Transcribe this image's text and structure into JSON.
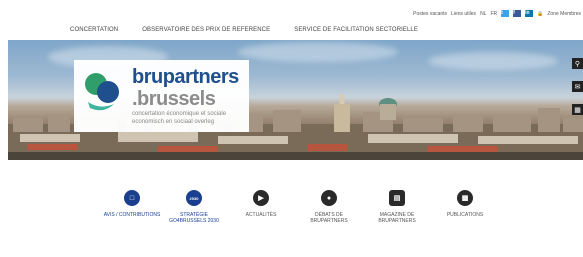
{
  "utility_bar": {
    "links": [
      "Postes vacants",
      "Liens utiles",
      "NL",
      "FR"
    ],
    "social": [
      "t",
      "f",
      "in"
    ],
    "member_zone": "Zone Membres"
  },
  "nav": {
    "items": [
      "CONCERTATION",
      "OBSERVATOIRE DES PRIX DE REFERENCE",
      "SERVICE DE FACILITATION SECTORIELLE"
    ]
  },
  "logo": {
    "name_line1": "brupartners",
    "name_line2": ".brussels",
    "subtitle_line1": "concertation économique et sociale",
    "subtitle_line2": "economisch en sociaal overleg"
  },
  "side_icons": [
    "search-icon",
    "mail-icon",
    "calendar-icon"
  ],
  "tiles": [
    {
      "label1": "AVIS / CONTRIBUTIONS",
      "label2": "",
      "icon": "document-icon",
      "accent": "#1b3f8f"
    },
    {
      "label1": "STRATÉGIE",
      "label2": "GO4BRUSSELS 2030",
      "icon": "2030-badge-icon",
      "icon_text": "2030",
      "accent": "#1b3f8f"
    },
    {
      "label1": "ACTUALITÉS",
      "label2": "",
      "icon": "megaphone-icon",
      "accent": "#2a2a2a"
    },
    {
      "label1": "DÉBATS DE",
      "label2": "BRUPARTNERS",
      "icon": "chat-icon",
      "accent": "#2a2a2a"
    },
    {
      "label1": "MAGAZINE DE",
      "label2": "BRUPARTNERS",
      "icon": "magazine-icon",
      "accent": "#2a2a2a"
    },
    {
      "label1": "PUBLICATIONS",
      "label2": "",
      "icon": "book-icon",
      "accent": "#2a2a2a"
    }
  ]
}
